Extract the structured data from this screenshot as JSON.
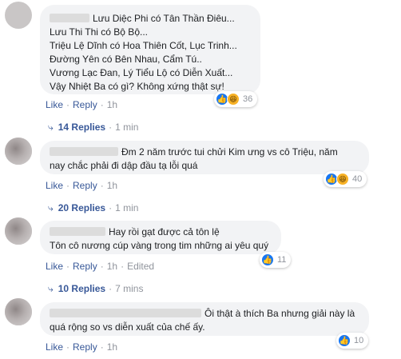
{
  "comments": [
    {
      "lines": [
        "Lưu Diệc Phi có Tân Thần Điêu...",
        "Lưu Thi Thi có Bộ Bộ...",
        "Triệu Lệ Dĩnh có Hoa Thiên Cốt, Lục Trinh...",
        "Đường Yên có Bên Nhau, Cẩm Tú..",
        "Vương Lạc Đan, Lý Tiểu Lộ có Diễn Xuất...",
        "Vậy Nhiệt Ba có gì? Không xứng thật sự!"
      ],
      "reaction_count": "36",
      "reactions": [
        "like",
        "haha"
      ],
      "like": "Like",
      "reply": "Reply",
      "time": "1h",
      "edited": "",
      "replies_label": "14 Replies",
      "replies_time": "1 min"
    },
    {
      "lines": [
        "Đm 2 năm trước tui chửi Kim ưng vs cô Triệu, năm",
        "nay chắc phải đi dập đầu tạ lỗi quá"
      ],
      "reaction_count": "40",
      "reactions": [
        "like",
        "haha"
      ],
      "like": "Like",
      "reply": "Reply",
      "time": "1h",
      "edited": "",
      "replies_label": "20 Replies",
      "replies_time": "1 min"
    },
    {
      "lines": [
        "Hay rồi gạt được cả tôn lệ",
        "Tôn cô nương cúp vàng trong tim những ai yêu quý"
      ],
      "reaction_count": "11",
      "reactions": [
        "like"
      ],
      "like": "Like",
      "reply": "Reply",
      "time": "1h",
      "edited": "Edited",
      "replies_label": "10 Replies",
      "replies_time": "7 mins"
    },
    {
      "lines": [
        "Ôi thật à thích Ba nhưng giải này là",
        "quá rộng so vs diễn xuất của chế ấy."
      ],
      "reaction_count": "10",
      "reactions": [
        "like"
      ],
      "like": "Like",
      "reply": "Reply",
      "time": "1h",
      "edited": "",
      "replies_label": "",
      "replies_time": ""
    }
  ],
  "icons": {
    "like": "like-icon",
    "haha": "haha-icon",
    "reply_arrow": "reply-arrow-icon"
  },
  "colors": {
    "bubble": "#f2f3f5",
    "link": "#385898",
    "muted": "#90949c",
    "like_blue": "#1877f2",
    "haha_yellow": "#f7b125"
  }
}
